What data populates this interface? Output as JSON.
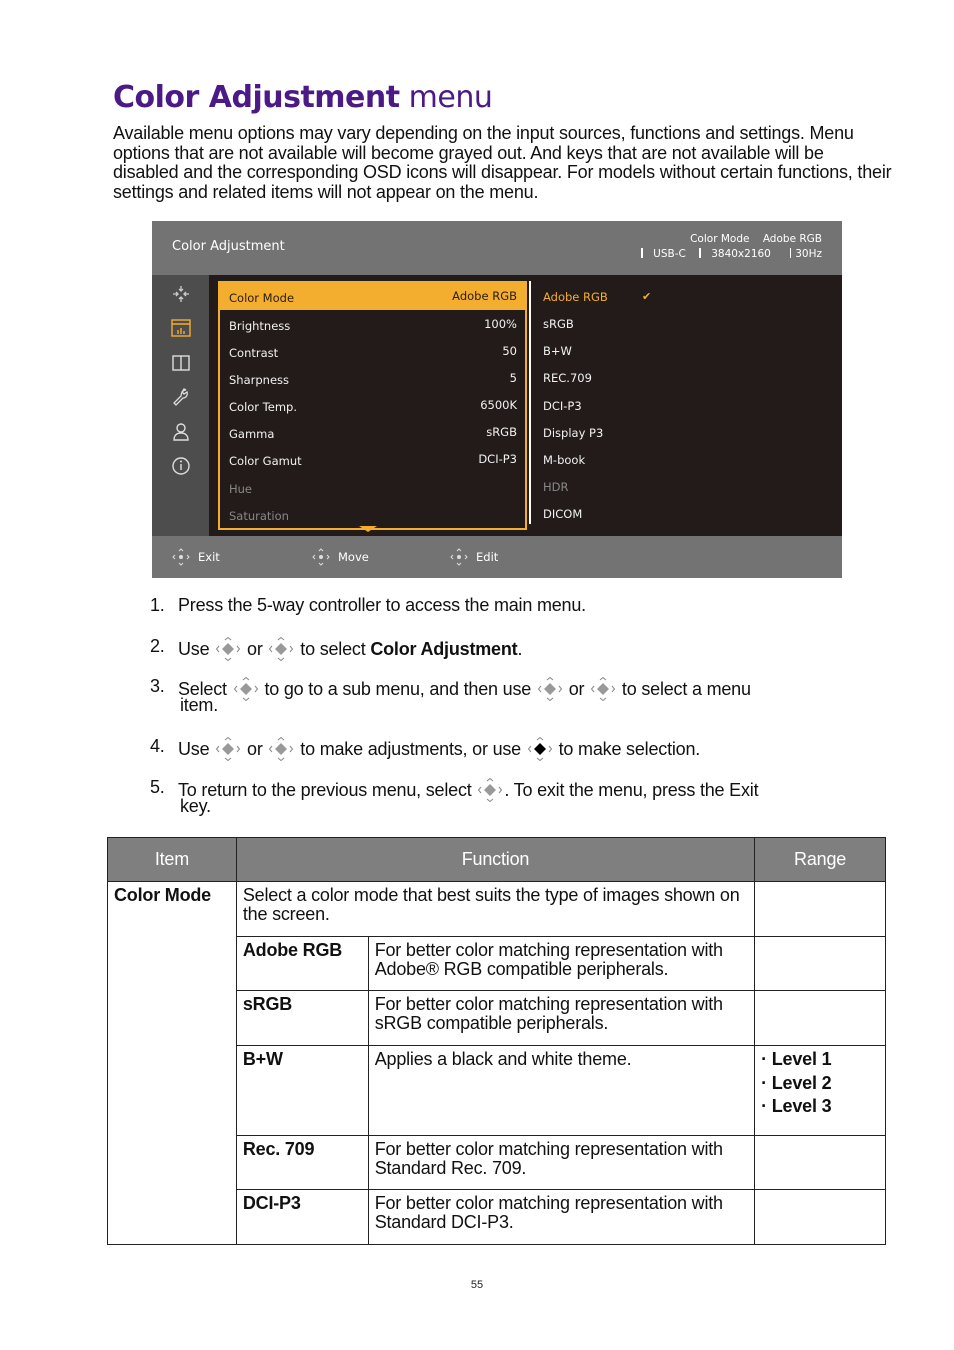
{
  "page": {
    "title_bold": "Color Adjustment",
    "title_rest": "menu",
    "intro": "Available menu options may vary depending on the input sources, functions and settings. Menu options that are not available will become grayed out. And keys that are not available will be disabled and the corresponding OSD icons will disappear. For models without certain functions, their settings and related items will not appear on the menu.",
    "page_number": "55"
  },
  "osd": {
    "header_title": "Color Adjustment",
    "info_mode_label": "Color Mode",
    "info_mode_value": "Adobe RGB",
    "info_input": "USB-C",
    "info_resolution": "3840x2160",
    "info_refresh": "30Hz",
    "sidebar_icons": [
      "focus-icon",
      "color-adjustment-icon",
      "split-screen-icon",
      "wrench-icon",
      "user-icon",
      "info-icon"
    ],
    "active_sidebar_index": 1,
    "accent_color": "#f3ad2f",
    "main_items": [
      {
        "label": "Color Mode",
        "value": "Adobe RGB",
        "state": "active"
      },
      {
        "label": "Brightness",
        "value": "100%",
        "state": "normal"
      },
      {
        "label": "Contrast",
        "value": "50",
        "state": "normal"
      },
      {
        "label": "Sharpness",
        "value": "5",
        "state": "normal"
      },
      {
        "label": "Color Temp.",
        "value": "6500K",
        "state": "normal"
      },
      {
        "label": "Gamma",
        "value": "sRGB",
        "state": "normal"
      },
      {
        "label": "Color Gamut",
        "value": "DCI-P3",
        "state": "normal"
      },
      {
        "label": "Hue",
        "value": "",
        "state": "disabled"
      },
      {
        "label": "Saturation",
        "value": "",
        "state": "disabled"
      }
    ],
    "sub_items": [
      {
        "label": "Adobe RGB",
        "state": "selected",
        "check": "✔"
      },
      {
        "label": "sRGB",
        "state": "normal"
      },
      {
        "label": "B+W",
        "state": "normal"
      },
      {
        "label": "REC.709",
        "state": "normal"
      },
      {
        "label": "DCI-P3",
        "state": "normal"
      },
      {
        "label": "Display P3",
        "state": "normal"
      },
      {
        "label": "M-book",
        "state": "normal"
      },
      {
        "label": "HDR",
        "state": "disabled"
      },
      {
        "label": "DICOM",
        "state": "normal"
      }
    ],
    "footer": {
      "exit": "Exit",
      "move": "Move",
      "edit": "Edit"
    }
  },
  "steps": [
    {
      "num": "1.",
      "parts": [
        "Press the 5-way controller to access the main menu."
      ]
    },
    {
      "num": "2.",
      "p1": "Use",
      "p2": "or",
      "p3": "to select",
      "bold": "Color Adjustment",
      "p4": "."
    },
    {
      "num": "3.",
      "p1": "Select",
      "p2": "to go to a sub menu, and then use",
      "p3": "or",
      "p4": "to select a menu",
      "cont": "item."
    },
    {
      "num": "4.",
      "p1": "Use",
      "p2": "or",
      "p3": "to make adjustments, or use",
      "p4": "to make selection."
    },
    {
      "num": "5.",
      "p1": "To return to the previous menu, select",
      "p2": ". To exit the menu, press the Exit",
      "cont": "key."
    }
  ],
  "table": {
    "headers": [
      "Item",
      "Function",
      "Range"
    ],
    "item": "Color Mode",
    "item_desc": "Select a color mode that best suits the type of images shown on the screen.",
    "rows": [
      {
        "name": "Adobe RGB",
        "desc": "For better color matching representation with Adobe® RGB compatible peripherals.",
        "range": []
      },
      {
        "name": "sRGB",
        "desc": "For better color matching representation with sRGB compatible peripherals.",
        "range": []
      },
      {
        "name": "B+W",
        "desc": "Applies a black and white theme.",
        "range": [
          "Level 1",
          "Level 2",
          "Level 3"
        ]
      },
      {
        "name": "Rec. 709",
        "desc": "For better color matching representation with Standard Rec. 709.",
        "range": []
      },
      {
        "name": "DCI-P3",
        "desc": "For better color matching representation with Standard DCI-P3.",
        "range": []
      }
    ],
    "bullet": "·"
  }
}
